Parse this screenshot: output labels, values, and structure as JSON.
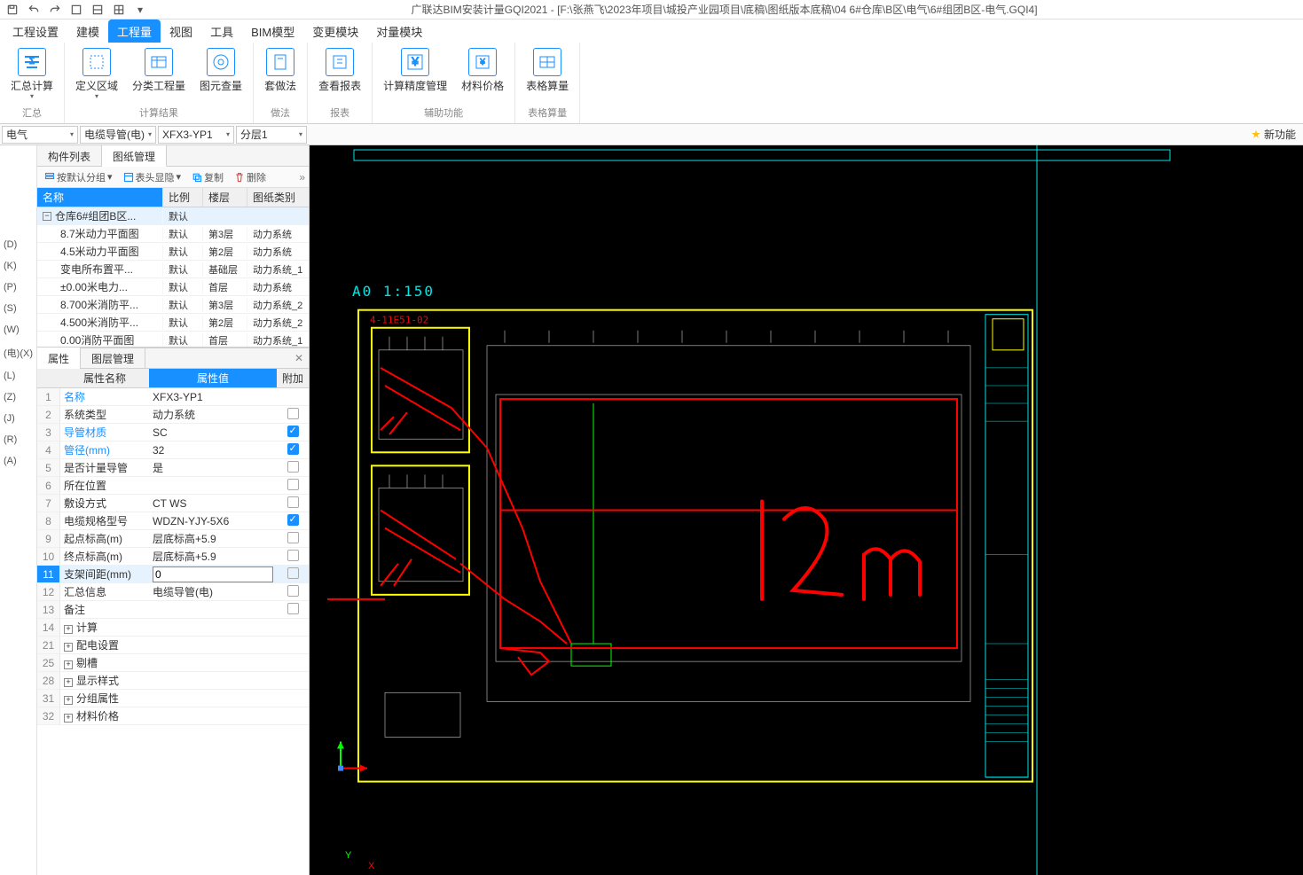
{
  "title": "广联达BIM安装计量GQI2021 - [F:\\张燕飞\\2023年项目\\城投产业园项目\\底稿\\图纸版本底稿\\04 6#仓库\\B区\\电气\\6#组团B区-电气.GQI4]",
  "menu": {
    "items": [
      "工程设置",
      "建模",
      "工程量",
      "视图",
      "工具",
      "BIM模型",
      "变更模块",
      "对量模块"
    ],
    "active": "工程量"
  },
  "ribbon": {
    "groups": [
      {
        "label": "汇总",
        "items": [
          {
            "label": "汇总计算",
            "hasDrop": true
          }
        ]
      },
      {
        "label": "计算结果",
        "items": [
          {
            "label": "定义区域",
            "hasDrop": true
          },
          {
            "label": "分类工程量"
          },
          {
            "label": "图元查量"
          }
        ]
      },
      {
        "label": "做法",
        "items": [
          {
            "label": "套做法"
          }
        ]
      },
      {
        "label": "报表",
        "items": [
          {
            "label": "查看报表"
          }
        ]
      },
      {
        "label": "辅助功能",
        "items": [
          {
            "label": "计算精度管理"
          },
          {
            "label": "材料价格"
          }
        ]
      },
      {
        "label": "表格算量",
        "items": [
          {
            "label": "表格算量"
          }
        ]
      }
    ]
  },
  "selectors": {
    "s1": "电气",
    "s2": "电缆导管(电)",
    "s3": "XFX3-YP1",
    "s4": "分层1",
    "newFeature": "新功能"
  },
  "farLeft": [
    "(D)",
    "(K)",
    "(P)",
    "(S)",
    "(W)",
    "(电)(X)",
    "(L)",
    "(Z)",
    "(J)",
    "(R)",
    "(A)"
  ],
  "leftTabs": {
    "tab1": "构件列表",
    "tab2": "图纸管理",
    "active": "图纸管理"
  },
  "toolbar1": {
    "btn1": "按默认分组",
    "btn2": "表头显隐",
    "btn3": "复制",
    "btn4": "删除"
  },
  "dwgHeader": {
    "name": "名称",
    "scale": "比例",
    "floor": "楼层",
    "type": "图纸类别"
  },
  "dwgRows": [
    {
      "name": "仓库6#组团B区...",
      "scale": "默认",
      "floor": "",
      "type": "",
      "group": true
    },
    {
      "name": "8.7米动力平面图",
      "scale": "默认",
      "floor": "第3层",
      "type": "动力系统"
    },
    {
      "name": "4.5米动力平面图",
      "scale": "默认",
      "floor": "第2层",
      "type": "动力系统"
    },
    {
      "name": "变电所布置平...",
      "scale": "默认",
      "floor": "基础层",
      "type": "动力系统_1"
    },
    {
      "name": "±0.00米电力...",
      "scale": "默认",
      "floor": "首层",
      "type": "动力系统"
    },
    {
      "name": "8.700米消防平...",
      "scale": "默认",
      "floor": "第3层",
      "type": "动力系统_2"
    },
    {
      "name": "4.500米消防平...",
      "scale": "默认",
      "floor": "第2层",
      "type": "动力系统_2"
    },
    {
      "name": "0.00消防平面图",
      "scale": "默认",
      "floor": "首层",
      "type": "动力系统_1"
    }
  ],
  "propTabs": {
    "tab1": "属性",
    "tab2": "图层管理",
    "active": "属性"
  },
  "propHeader": {
    "idx": "",
    "name": "属性名称",
    "val": "属性值",
    "add": "附加"
  },
  "propRows": [
    {
      "idx": "1",
      "name": "名称",
      "val": "XFX3-YP1",
      "link": true,
      "chk": null
    },
    {
      "idx": "2",
      "name": "系统类型",
      "val": "动力系统",
      "chk": false
    },
    {
      "idx": "3",
      "name": "导管材质",
      "val": "SC",
      "link": true,
      "chk": true
    },
    {
      "idx": "4",
      "name": "管径(mm)",
      "val": "32",
      "link": true,
      "chk": true
    },
    {
      "idx": "5",
      "name": "是否计量导管",
      "val": "是",
      "chk": false
    },
    {
      "idx": "6",
      "name": "所在位置",
      "val": "",
      "chk": false
    },
    {
      "idx": "7",
      "name": "敷设方式",
      "val": "CT WS",
      "chk": false
    },
    {
      "idx": "8",
      "name": "电缆规格型号",
      "val": "WDZN-YJY-5X6",
      "chk": true
    },
    {
      "idx": "9",
      "name": "起点标高(m)",
      "val": "层底标高+5.9",
      "chk": false
    },
    {
      "idx": "10",
      "name": "终点标高(m)",
      "val": "层底标高+5.9",
      "chk": false
    },
    {
      "idx": "11",
      "name": "支架间距(mm)",
      "val": "0",
      "chk": false,
      "selected": true,
      "edit": true
    },
    {
      "idx": "12",
      "name": "汇总信息",
      "val": "电缆导管(电)",
      "chk": false
    },
    {
      "idx": "13",
      "name": "备注",
      "val": "",
      "chk": false
    },
    {
      "idx": "14",
      "name": "计算",
      "val": "",
      "chk": null,
      "expand": true
    },
    {
      "idx": "21",
      "name": "配电设置",
      "val": "",
      "chk": null,
      "expand": true
    },
    {
      "idx": "25",
      "name": "剔槽",
      "val": "",
      "chk": null,
      "expand": true
    },
    {
      "idx": "28",
      "name": "显示样式",
      "val": "",
      "chk": null,
      "expand": true
    },
    {
      "idx": "31",
      "name": "分组属性",
      "val": "",
      "chk": null,
      "expand": true
    },
    {
      "idx": "32",
      "name": "材料价格",
      "val": "",
      "chk": null,
      "expand": true
    }
  ],
  "canvas": {
    "scaleLabel": "A0  1:150",
    "dwgLabel": "4-11E51-02",
    "annotation": "12m",
    "axisX": "X",
    "axisY": "Y"
  }
}
